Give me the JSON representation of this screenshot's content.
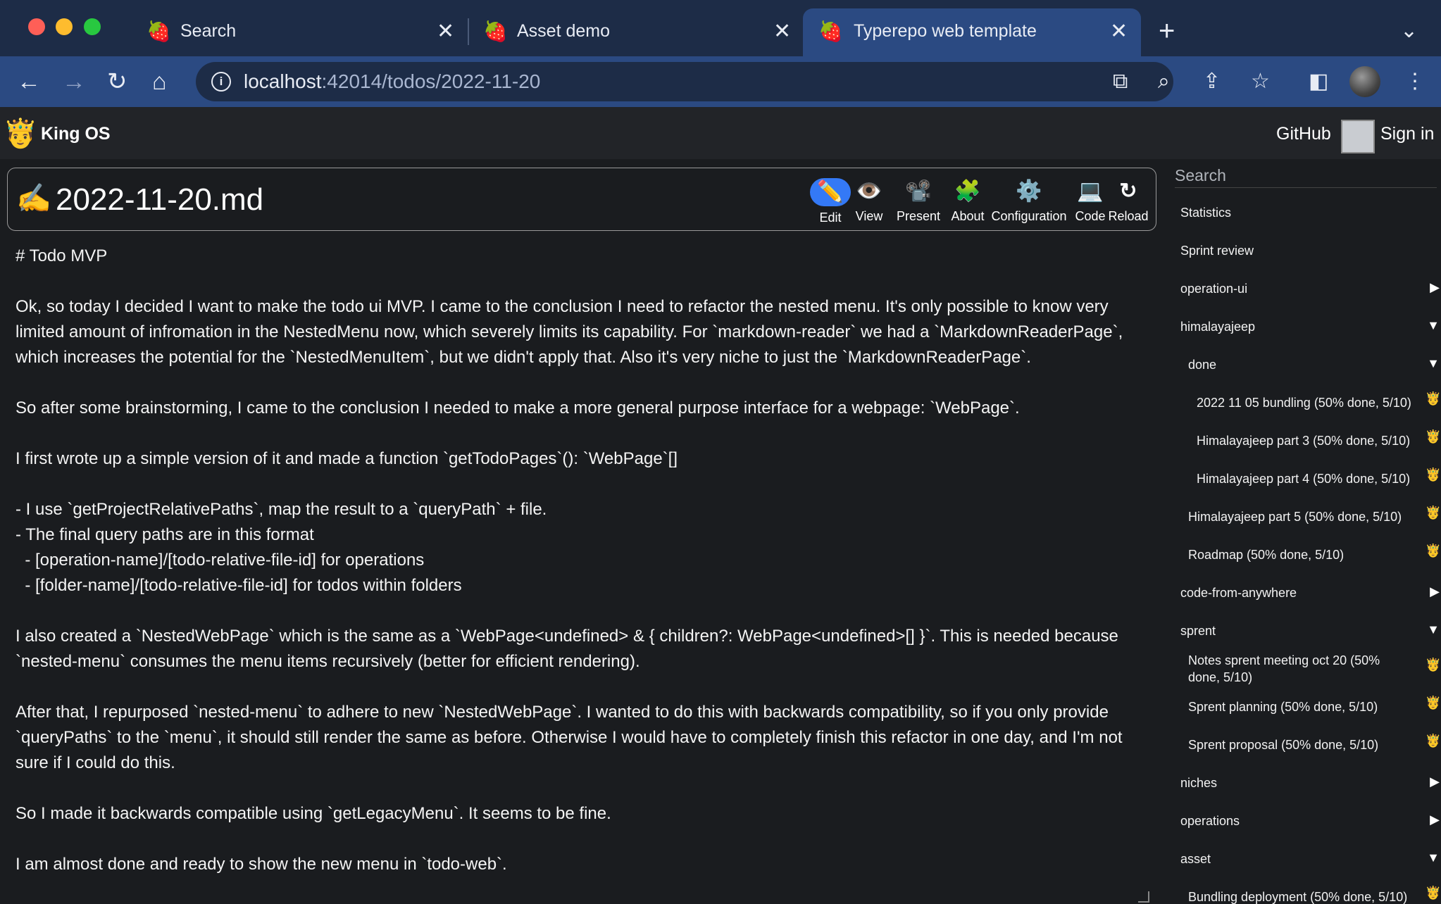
{
  "browser": {
    "tabs": [
      {
        "title": "Search",
        "favicon": "🍓"
      },
      {
        "title": "Asset demo",
        "favicon": "🍓"
      },
      {
        "title": "Typerepo web template",
        "favicon": "🍓"
      }
    ],
    "url_host": "localhost",
    "url_rest": ":42014/todos/2022-11-20"
  },
  "app": {
    "brand": "King OS",
    "logo": "🤴",
    "github": "GitHub",
    "sign_in": "Sign in"
  },
  "doc": {
    "icon": "✍️",
    "title": "2022-11-20.md",
    "actions": [
      {
        "label": "Edit",
        "icon": "✏️",
        "active": true
      },
      {
        "label": "View",
        "icon": "👁️"
      },
      {
        "label": "Present",
        "icon": "📽️"
      },
      {
        "label": "About",
        "icon": "🧩"
      },
      {
        "label": "Configuration",
        "icon": "⚙️"
      },
      {
        "label": "Code",
        "icon": "💻"
      },
      {
        "label": "Reload",
        "icon": "↻"
      }
    ]
  },
  "content": {
    "p1": "# Todo MVP",
    "p2": "Ok, so today I decided I want to make the todo ui MVP. I came to the conclusion I need to refactor the nested menu. It's only possible to know very limited amount of infromation in the NestedMenu now, which severely limits its capability. For `markdown-reader` we had a `MarkdownReaderPage`, which increases the potential for the `NestedMenuItem`, but we didn't apply that. Also it's very niche to just the `MarkdownReaderPage`.",
    "p3": "So after some brainstorming, I came to the conclusion I needed to make a more general purpose interface for a webpage: `WebPage`.",
    "p4": "I first wrote up a simple version of it and made a function `getTodoPages`(): `WebPage`[]",
    "list1": "- I use `getProjectRelativePaths`, map the result to a `queryPath` + file.",
    "list2": "- The final query paths are in this format",
    "list3": "  - [operation-name]/[todo-relative-file-id] for operations",
    "list4": "  - [folder-name]/[todo-relative-file-id] for todos within folders",
    "p5": "I also created a `NestedWebPage` which is the same as a `WebPage<undefined> & { children?: WebPage<undefined>[] }`. This is needed because `nested-menu` consumes the menu items recursively (better for efficient rendering).",
    "p6": "After that, I repurposed `nested-menu` to adhere to new `NestedWebPage`. I wanted to do this with backwards compatibility, so if you only provide `queryPaths` to the `menu`, it should still render the same as before. Otherwise I would have to completely finish this refactor in one day, and I'm not sure if I could do this.",
    "p7": "So I made it backwards compatible using `getLegacyMenu`. It seems to be fine.",
    "p8": "I am almost done and ready to show the new menu in `todo-web`."
  },
  "sidebar": {
    "search_placeholder": "Search",
    "items": [
      {
        "label": "Statistics",
        "level": 0,
        "marker": ""
      },
      {
        "label": "Sprint review",
        "level": 0,
        "marker": ""
      },
      {
        "label": "operation-ui",
        "level": 0,
        "marker": "▶"
      },
      {
        "label": "himalayajeep",
        "level": 0,
        "marker": "▼"
      },
      {
        "label": "done",
        "level": 1,
        "marker": "▼"
      },
      {
        "label": "2022 11 05 bundling (50% done, 5/10)",
        "level": 2,
        "marker": "🤴"
      },
      {
        "label": "Himalayajeep part 3 (50% done, 5/10)",
        "level": 2,
        "marker": "🤴"
      },
      {
        "label": "Himalayajeep part 4 (50% done, 5/10)",
        "level": 2,
        "marker": "🤴"
      },
      {
        "label": "Himalayajeep part 5 (50% done, 5/10)",
        "level": 1,
        "marker": "🤴"
      },
      {
        "label": "Roadmap (50% done, 5/10)",
        "level": 1,
        "marker": "🤴"
      },
      {
        "label": "code-from-anywhere",
        "level": 0,
        "marker": "▶"
      },
      {
        "label": "sprent",
        "level": 0,
        "marker": "▼"
      },
      {
        "label": "Notes sprent meeting oct 20 (50% done, 5/10)",
        "level": 1,
        "marker": "🤴",
        "wrap": true
      },
      {
        "label": "Sprent planning (50% done, 5/10)",
        "level": 1,
        "marker": "🤴"
      },
      {
        "label": "Sprent proposal (50% done, 5/10)",
        "level": 1,
        "marker": "🤴"
      },
      {
        "label": "niches",
        "level": 0,
        "marker": "▶"
      },
      {
        "label": "operations",
        "level": 0,
        "marker": "▶"
      },
      {
        "label": "asset",
        "level": 0,
        "marker": "▼"
      },
      {
        "label": "Bundling deployment (50% done, 5/10)",
        "level": 1,
        "marker": "🤴"
      }
    ]
  }
}
